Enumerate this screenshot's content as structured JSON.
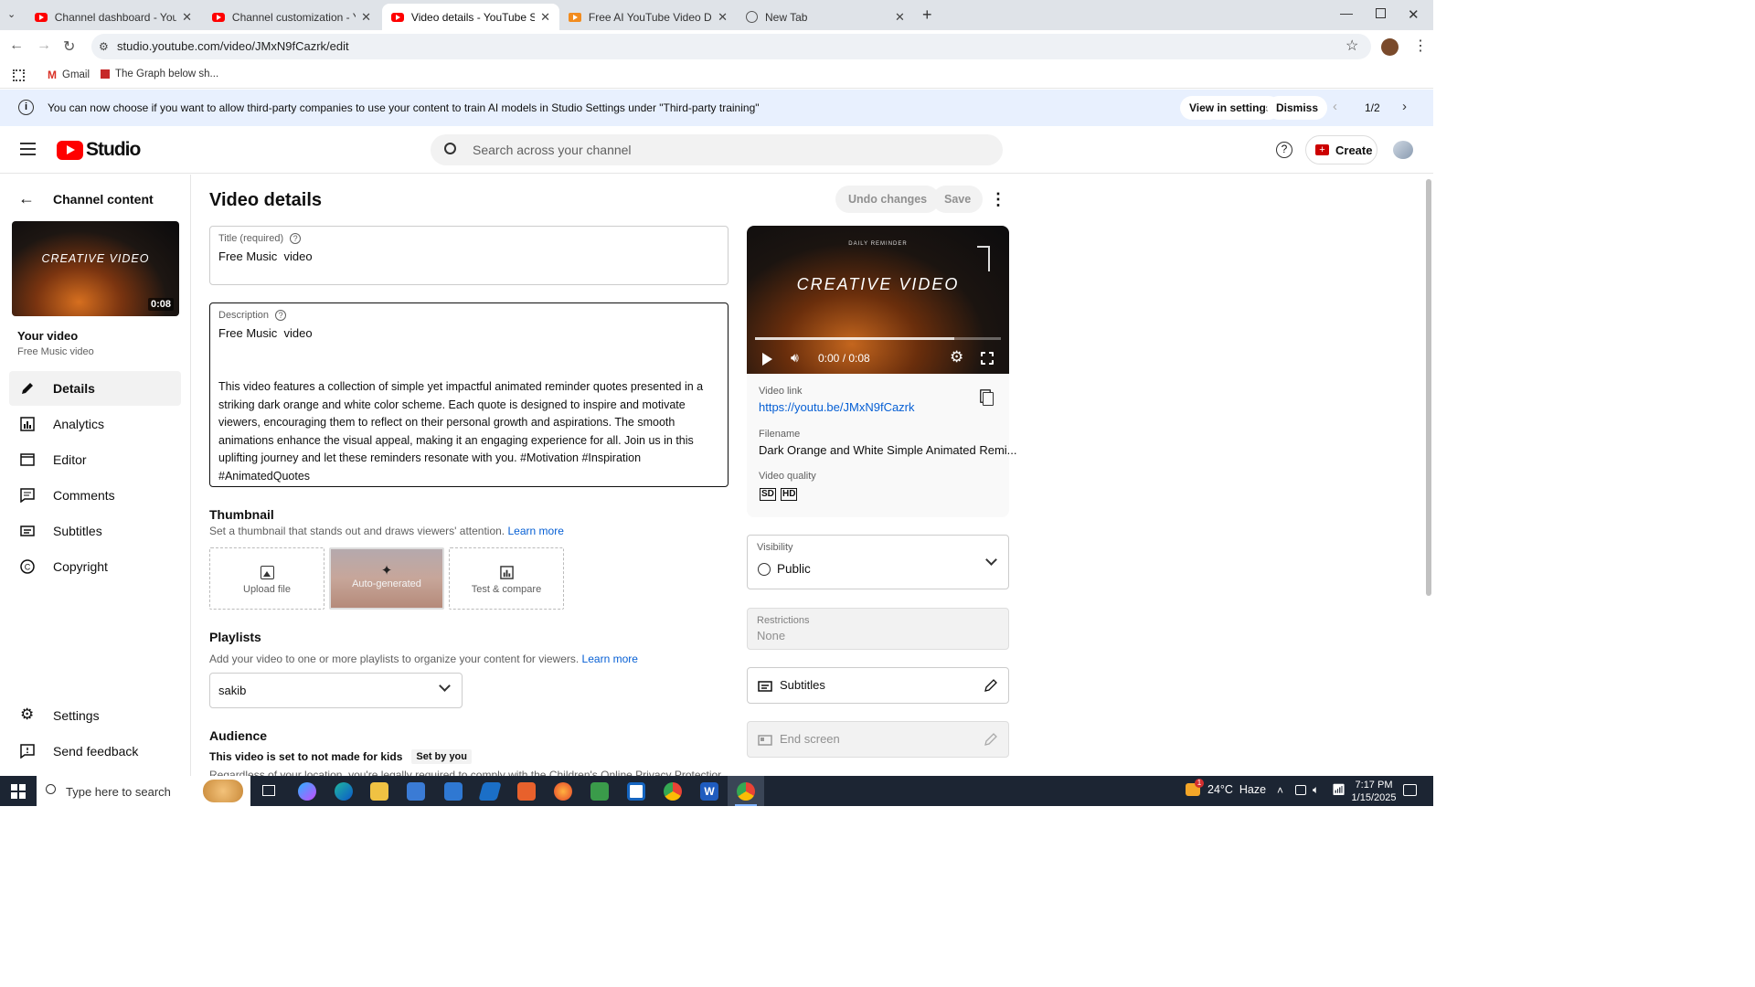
{
  "browser": {
    "tabs": [
      {
        "label": "Channel dashboard - YouTube",
        "icon": "youtube-favicon"
      },
      {
        "label": "Channel customization - YouTube",
        "icon": "youtube-favicon"
      },
      {
        "label": "Video details - YouTube Studio",
        "icon": "youtube-favicon",
        "active": true
      },
      {
        "label": "Free AI YouTube Video Descript",
        "icon": "ahrefs-favicon"
      },
      {
        "label": "New Tab",
        "icon": "chrome-favicon"
      }
    ],
    "url": "studio.youtube.com/video/JMxN9fCazrk/edit",
    "bookmarks": [
      {
        "label": "Gmail",
        "icon": "gmail-icon"
      },
      {
        "label": "The Graph below sh...",
        "icon": "bookmark-icon"
      }
    ]
  },
  "notice": {
    "text": "You can now choose if you want to allow third-party companies to use your content to train AI models in Studio Settings under \"Third-party training\"",
    "view_settings": "View in settings",
    "dismiss": "Dismiss",
    "pager": "1/2"
  },
  "header": {
    "logo_text": "Studio",
    "search_placeholder": "Search across your channel",
    "create_label": "Create"
  },
  "sidebar": {
    "back_label": "Channel content",
    "thumb_title": "CREATIVE VIDEO",
    "thumb_duration": "0:08",
    "your_video_label": "Your video",
    "video_name": "Free Music video",
    "items": [
      {
        "label": "Details",
        "icon": "pencil-icon",
        "active": true
      },
      {
        "label": "Analytics",
        "icon": "analytics-icon"
      },
      {
        "label": "Editor",
        "icon": "editor-icon"
      },
      {
        "label": "Comments",
        "icon": "comments-icon"
      },
      {
        "label": "Subtitles",
        "icon": "subtitles-icon"
      },
      {
        "label": "Copyright",
        "icon": "copyright-icon"
      }
    ],
    "settings_label": "Settings",
    "feedback_label": "Send feedback"
  },
  "main": {
    "page_title": "Video details",
    "undo_label": "Undo changes",
    "save_label": "Save",
    "title_label": "Title (required)",
    "title_value": "Free Music  video",
    "description_label": "Description",
    "description_first": "Free Music  video",
    "description_body": "This video features a collection of simple yet impactful animated reminder quotes presented in a striking dark orange and white color scheme. Each quote is designed to inspire and motivate viewers, encouraging them to reflect on their personal growth and aspirations. The smooth animations enhance the visual appeal, making it an engaging experience for all. Join us in this uplifting journey and let these reminders resonate with you. #Motivation #Inspiration #AnimatedQuotes",
    "thumbnail_title": "Thumbnail",
    "thumbnail_help": "Set a thumbnail that stands out and draws viewers' attention.",
    "learn_more": "Learn more",
    "thumb_upload": "Upload file",
    "thumb_auto": "Auto-generated",
    "thumb_test": "Test & compare",
    "playlists_title": "Playlists",
    "playlists_help": "Add your video to one or more playlists to organize your content for viewers.",
    "playlist_value": "sakib",
    "audience_title": "Audience",
    "audience_text": "This video is set to not made for kids",
    "audience_badge": "Set by you",
    "audience_cut": "Regardless of your location, you're legally required to comply with the Children's Online Privacy Protection Act (COPPA)"
  },
  "right": {
    "player_small_text": "DAILY REMINDER",
    "player_title": "CREATIVE VIDEO",
    "player_time": "0:00 / 0:08",
    "playback_progress": 0,
    "video_link_label": "Video link",
    "video_link": "https://youtu.be/JMxN9fCazrk",
    "filename_label": "Filename",
    "filename": "Dark Orange and White Simple Animated Remi...",
    "quality_label": "Video quality",
    "quality_sd": "SD",
    "quality_hd": "HD",
    "visibility_label": "Visibility",
    "visibility_value": "Public",
    "restrictions_label": "Restrictions",
    "restrictions_value": "None",
    "subtitles_label": "Subtitles",
    "endscreen_label": "End screen"
  },
  "taskbar": {
    "search_placeholder": "Type here to search",
    "weather": "24°C  Haze",
    "time": "7:17 PM",
    "date": "1/15/2025",
    "weather_badge": "1"
  },
  "colors": {
    "youtube_red": "#ff0000",
    "link_blue": "#065fd4",
    "notice_bg": "#e8f0fe",
    "taskbar_bg": "#1c2533"
  }
}
